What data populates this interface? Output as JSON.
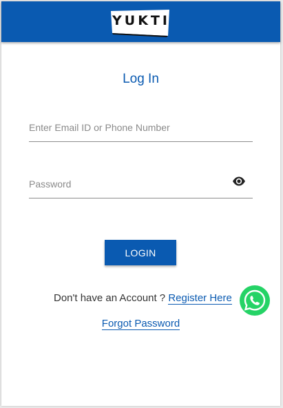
{
  "header": {
    "logo_text": "YUKTI",
    "background_color": "#0a5ab1"
  },
  "login_form": {
    "title": "Log In",
    "email_placeholder": "Enter Email ID or Phone Number",
    "password_placeholder": "Password",
    "password_toggle_icon": "eye-icon",
    "login_button_label": "LOGIN"
  },
  "footer_links": {
    "register_prompt": "Don't have an Account ? ",
    "register_link": "Register Here",
    "forgot_password": "Forgot Password"
  },
  "floating": {
    "icon": "whatsapp-icon",
    "color": "#25d366"
  },
  "colors": {
    "accent": "#0a5ab1"
  }
}
